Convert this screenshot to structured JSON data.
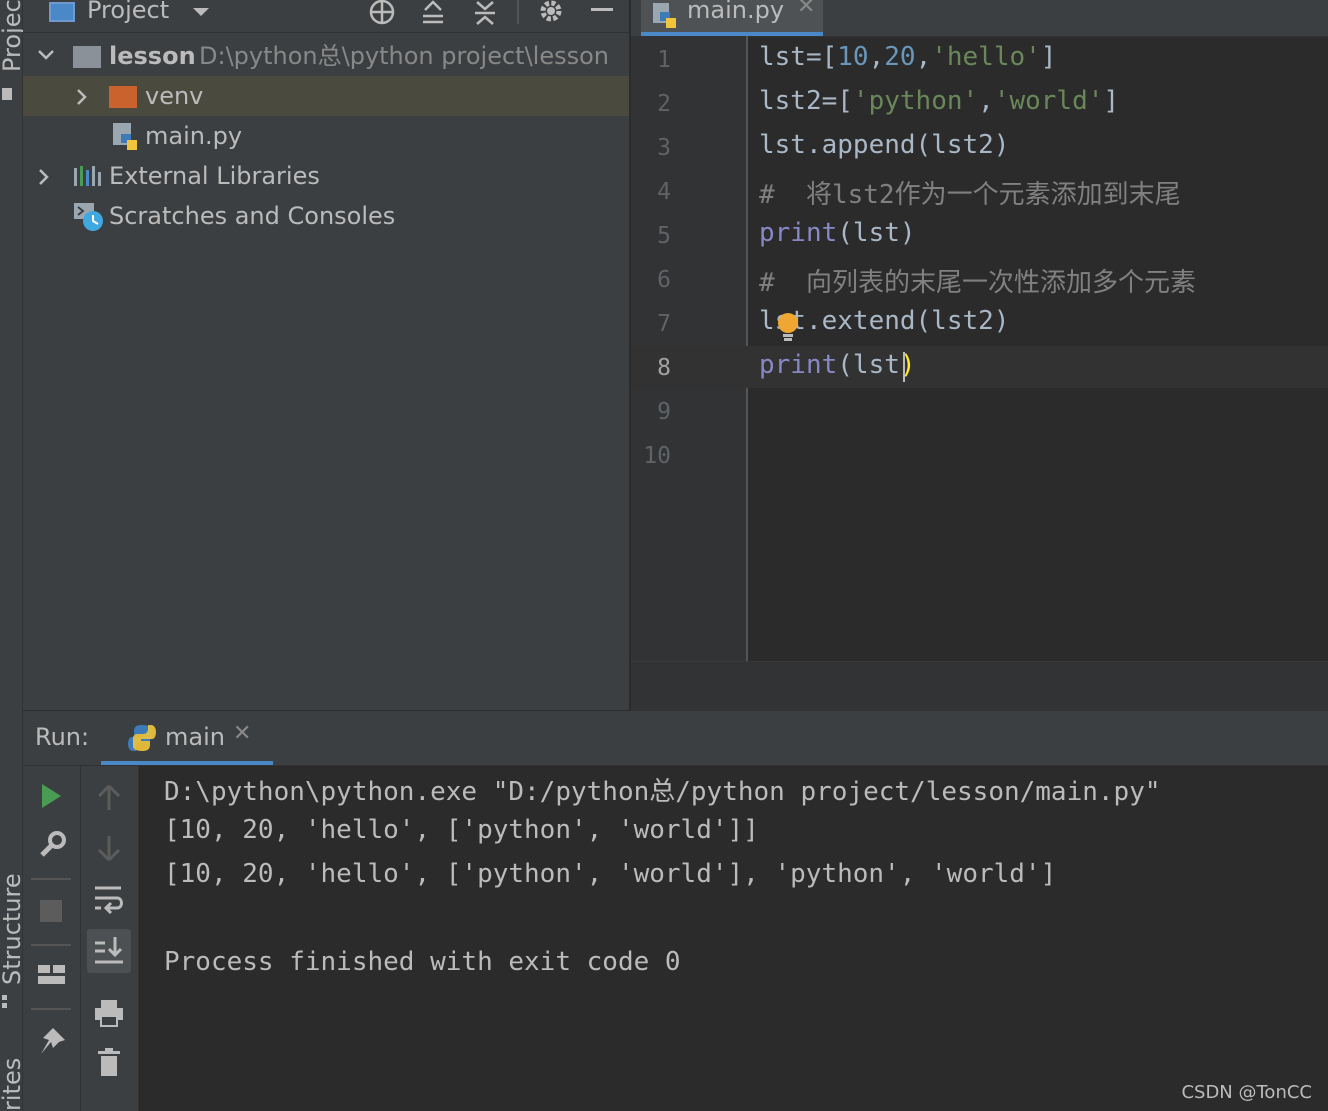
{
  "left_stripe": {
    "project_tab": "Project",
    "structure_tab": "Structure",
    "favorites_tab": "rites"
  },
  "project_panel": {
    "title": "Project",
    "tree": [
      {
        "name": "lesson",
        "path": "D:\\python总\\python project\\lesson"
      },
      {
        "name": "venv"
      },
      {
        "name": "main.py"
      },
      {
        "name": "External Libraries"
      },
      {
        "name": "Scratches and Consoles"
      }
    ]
  },
  "editor": {
    "tab_label": "main.py",
    "line_numbers": [
      "1",
      "2",
      "3",
      "4",
      "5",
      "6",
      "7",
      "8",
      "9",
      "10"
    ],
    "lines": [
      {
        "a": "lst=[",
        "b": "10",
        "c": ",",
        "d": "20",
        "e": ",",
        "f": "'hello'",
        "g": "]"
      },
      {
        "a": "lst2=[",
        "b": "'python'",
        "c": ",",
        "d": "'world'",
        "e": "]"
      },
      {
        "a": "lst.append(lst2)"
      },
      {
        "a": "#  将lst2作为一个元素添加到末尾"
      },
      {
        "a": "print",
        "b": "(lst)"
      },
      {
        "a": "#  向列表的末尾一次性添加多个元素"
      },
      {
        "a": "lst.extend(lst2)"
      },
      {
        "a": "print",
        "b": "(lst",
        "c": ")"
      }
    ]
  },
  "run_panel": {
    "label": "Run:",
    "tab_label": "main",
    "output": [
      "D:\\python\\python.exe \"D:/python总/python project/lesson/main.py\"",
      "[10, 20, 'hello', ['python', 'world']]",
      "[10, 20, 'hello', ['python', 'world'], 'python', 'world']",
      "",
      "Process finished with exit code 0"
    ]
  },
  "watermark": "CSDN @TonCC",
  "colors": {
    "accent": "#4a88c7",
    "run_green": "#499c54",
    "folder_orange": "#c9622c",
    "bulb": "#f0a732"
  }
}
